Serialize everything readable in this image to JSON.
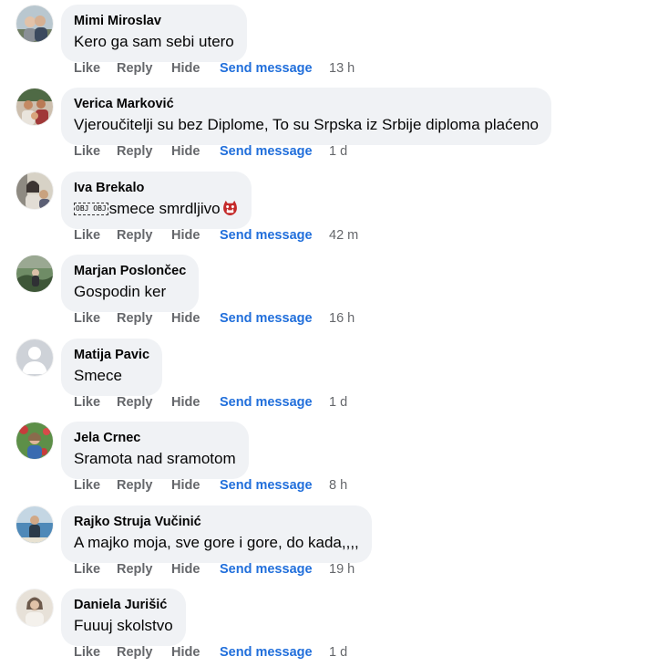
{
  "comments": [
    {
      "author": "Mimi Miroslav",
      "text": "Kero ga sam sebi utero",
      "time": "13 h",
      "avatar_colors": [
        "#b9c7cf",
        "#6f7d63",
        "#e2c2a8"
      ]
    },
    {
      "author": "Verica Marković",
      "text": "Vjeroučitelji su bez Diplome, To su Srpska iz Srbije diploma plaćeno",
      "time": "1 d",
      "avatar_colors": [
        "#cdbfae",
        "#4f6a45",
        "#c48a63"
      ]
    },
    {
      "author": "Iva Brekalo",
      "text_glyph": "OBJ OBJ",
      "text": "smece smrdljivo",
      "time": "42 m",
      "avatar_colors": [
        "#d7d2c6",
        "#3c3532",
        "#a07c64"
      ]
    },
    {
      "author": "Marjan Poslončec",
      "text": "Gospodin ker",
      "time": "16 h",
      "avatar_colors": [
        "#6f8c66",
        "#3e5638",
        "#9aa892"
      ]
    },
    {
      "author": "Matija Pavic",
      "text": "Smece",
      "time": "1 d",
      "avatar_colors": [
        "#ced2d8",
        "#ffffff",
        "#ffffff"
      ]
    },
    {
      "author": "Jela Crnec",
      "text": "Sramota nad sramotom",
      "time": "8 h",
      "avatar_colors": [
        "#5d8f48",
        "#c73c3c",
        "#e0b59a"
      ]
    },
    {
      "author": "Rajko Struja Vučinić",
      "text": "A majko moja, sve gore i gore, do kada,,,,",
      "time": "19 h",
      "avatar_colors": [
        "#4f89b8",
        "#c4d6e3",
        "#2b3b4a"
      ]
    },
    {
      "author": "Daniela Jurišić",
      "text": "Fuuuj skolstvo",
      "time": "1 d",
      "avatar_colors": [
        "#e7e1d8",
        "#caa98f",
        "#6d5a4c"
      ]
    }
  ],
  "actions": {
    "like": "Like",
    "reply": "Reply",
    "hide": "Hide",
    "send": "Send message"
  },
  "colors": {
    "bubble": "#f0f2f5",
    "action_text": "#65676b",
    "send_message": "#216fdb"
  },
  "icons": {
    "reaction_emoji": "ogre-mask-icon"
  }
}
